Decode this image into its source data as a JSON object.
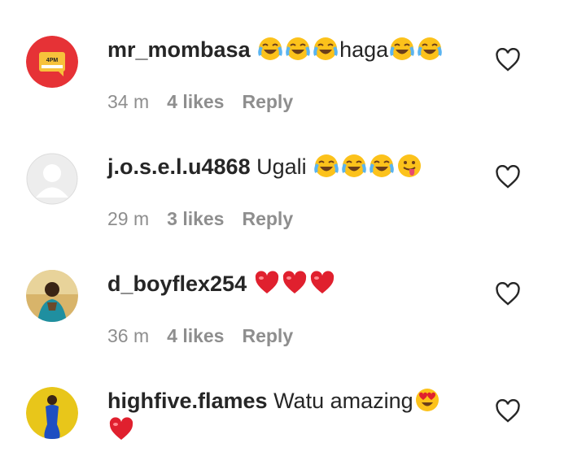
{
  "comments": [
    {
      "username": "mr_mombasa",
      "text_segments": [
        "",
        "haga",
        ""
      ],
      "emoji_line": "😂😂😂haga😂😂",
      "time": "34 m",
      "likes": "4 likes",
      "reply": "Reply",
      "avatar_text": [
        "4PM",
        "NEWS"
      ]
    },
    {
      "username": "j.o.s.e.l.u4868",
      "text": "Ugali",
      "emoji_line": "😂😂😂😛",
      "time": "29 m",
      "likes": "3 likes",
      "reply": "Reply"
    },
    {
      "username": "d_boyflex254",
      "emoji_line": "❤️❤️❤️",
      "time": "36 m",
      "likes": "4 likes",
      "reply": "Reply"
    },
    {
      "username": "highfive.flames",
      "text": "Watu amazing",
      "emoji_line": "😍 ❤️"
    }
  ],
  "icons": {
    "laugh": "face-with-tears-of-joy-icon",
    "tongue": "face-with-tongue-icon",
    "heart_red": "red-heart-icon",
    "heart_eyes": "heart-eyes-icon",
    "like": "heart-outline-icon"
  },
  "colors": {
    "meta": "#8e8e8e",
    "text": "#262626",
    "heart_red": "#e0202e"
  }
}
